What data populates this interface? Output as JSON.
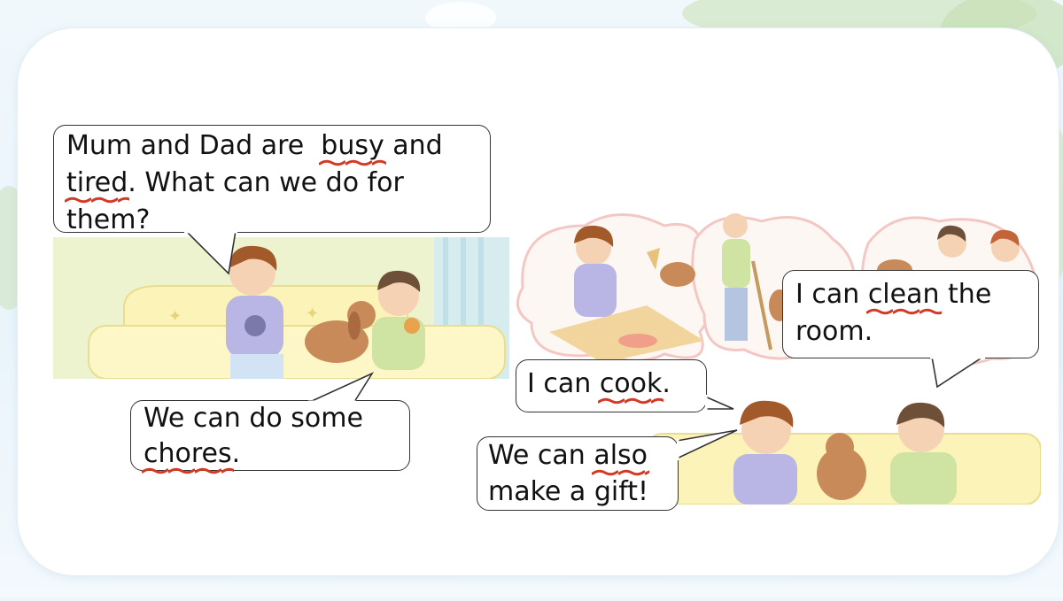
{
  "bubbles": {
    "mum_dad": {
      "line1_a": "Mum and Dad are  ",
      "line1_u": "busy",
      "line1_b": " and",
      "line2_u": "tired",
      "line2_b": ". What can we do for",
      "line3": "them?"
    },
    "chores": {
      "line1": "We can do some",
      "line2_u": "chores",
      "line2_b": "."
    },
    "clean": {
      "line1_a": "I can ",
      "line1_u": "clean",
      "line1_b": " the",
      "line2": "room."
    },
    "cook": {
      "line1_a": "I can ",
      "line1_u": "cook",
      "line1_b": "."
    },
    "gift": {
      "line1_a": "We can ",
      "line1_u": "also",
      "line2": "make a gift!"
    }
  },
  "colors": {
    "underline": "#d23a26",
    "bubble_border": "#333333",
    "panel_bg": "#ffffff",
    "page_bg": "#eef6fb"
  },
  "images": {
    "left_scene": "boys-and-dog-on-sofa-illustration",
    "right_scene": "thought-clouds-cooking-cleaning-illustration"
  }
}
